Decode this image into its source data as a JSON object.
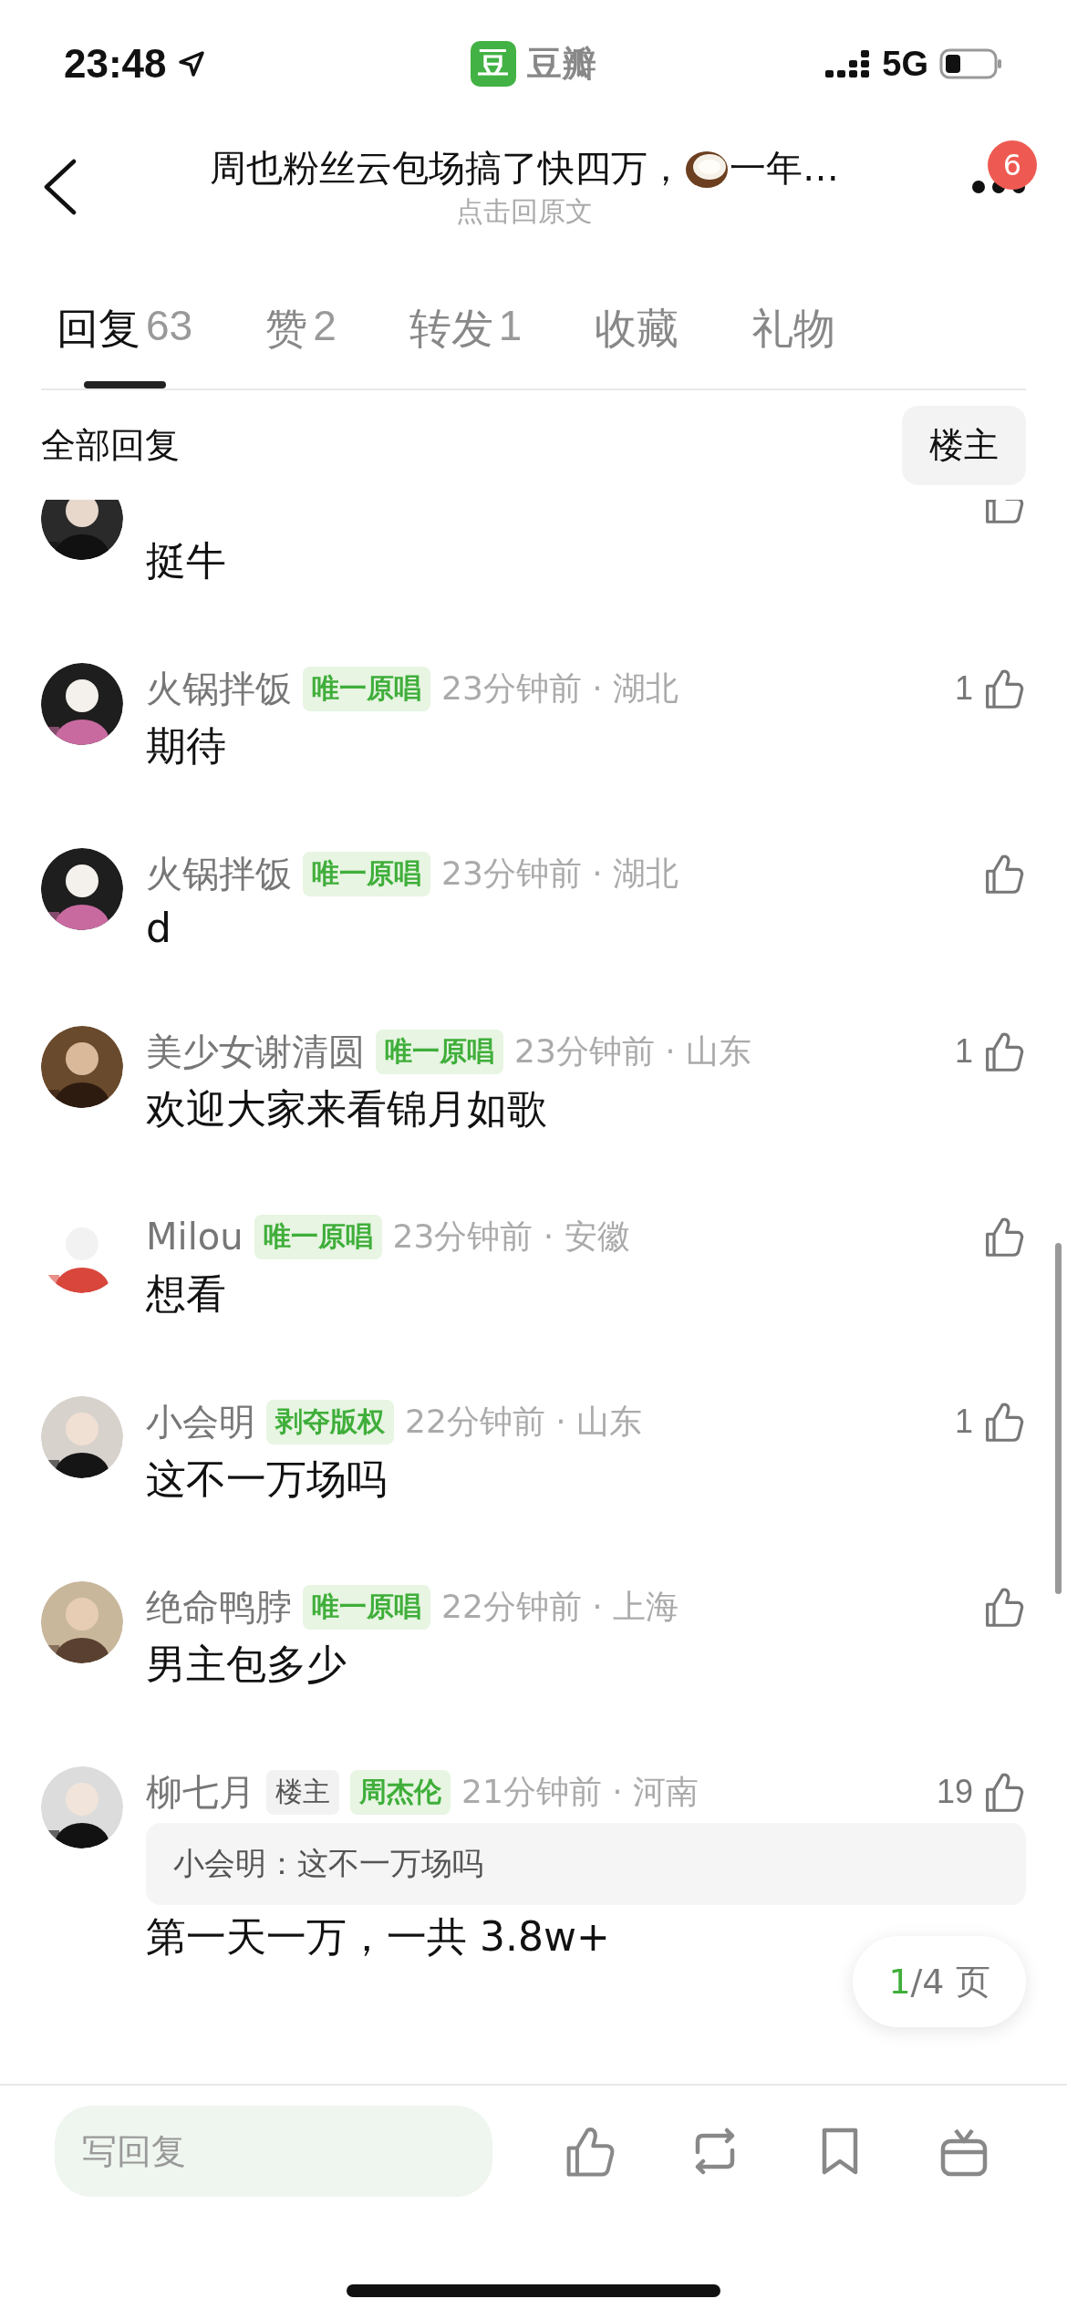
{
  "status_bar": {
    "time": "23:48",
    "app_icon_text": "豆",
    "app": "豆瓣",
    "network": "5G"
  },
  "header": {
    "title_start": "周也粉丝云包场搞了快四万，",
    "title_end": "一年…",
    "subtitle": "点击回原文",
    "badge": "6"
  },
  "tabs": [
    {
      "label": "回复",
      "count": "63",
      "selected": true
    },
    {
      "label": "赞",
      "count": "2",
      "selected": false
    },
    {
      "label": "转发",
      "count": "1",
      "selected": false
    },
    {
      "label": "收藏",
      "selected": false
    },
    {
      "label": "礼物",
      "selected": false
    }
  ],
  "filter": {
    "label": "全部回复",
    "button": "楼主"
  },
  "comments": [
    {
      "avatar": {
        "kind": "picture"
      },
      "text": "挺牛"
    },
    {
      "avatar": {
        "kind": "picture"
      },
      "name": "火锅拌饭",
      "tags": [
        {
          "text": "唯一原唱",
          "kind": "badge"
        }
      ],
      "meta": "23分钟前 · 湖北",
      "likes": "1",
      "text": "期待"
    },
    {
      "avatar": {
        "kind": "picture"
      },
      "name": "火锅拌饭",
      "tags": [
        {
          "text": "唯一原唱",
          "kind": "badge"
        }
      ],
      "meta": "23分钟前 · 湖北",
      "text": "d"
    },
    {
      "avatar": {
        "kind": "picture"
      },
      "name": "美少女谢清圆",
      "tags": [
        {
          "text": "唯一原唱",
          "kind": "badge"
        }
      ],
      "meta": "23分钟前 · 山东",
      "likes": "1",
      "text": "欢迎大家来看锦月如歌"
    },
    {
      "avatar": {
        "kind": "picture"
      },
      "name": "Milou",
      "tags": [
        {
          "text": "唯一原唱",
          "kind": "badge"
        }
      ],
      "meta": "23分钟前 · 安徽",
      "text": "想看"
    },
    {
      "avatar": {
        "kind": "picture"
      },
      "name": "小会明",
      "tags": [
        {
          "text": "剥夺版权",
          "kind": "badge"
        }
      ],
      "meta": "22分钟前 · 山东",
      "likes": "1",
      "text": "这不一万场吗"
    },
    {
      "avatar": {
        "kind": "picture"
      },
      "name": "绝命鸭脖",
      "tags": [
        {
          "text": "唯一原唱",
          "kind": "badge"
        }
      ],
      "meta": "22分钟前 · 上海",
      "text": "男主包多少"
    },
    {
      "avatar": {
        "kind": "picture"
      },
      "name": "柳七月",
      "tags": [
        {
          "text": "楼主",
          "kind": "author"
        },
        {
          "text": "周杰伦",
          "kind": "badge"
        }
      ],
      "meta": "21分钟前 · 河南",
      "likes": "19",
      "quote": "小会明：这不一万场吗",
      "text": "第一天一万，一共 3.8w+"
    }
  ],
  "page_indicator": {
    "current": "1",
    "total": "/4 页"
  },
  "reply_bar": {
    "placeholder": "写回复"
  }
}
